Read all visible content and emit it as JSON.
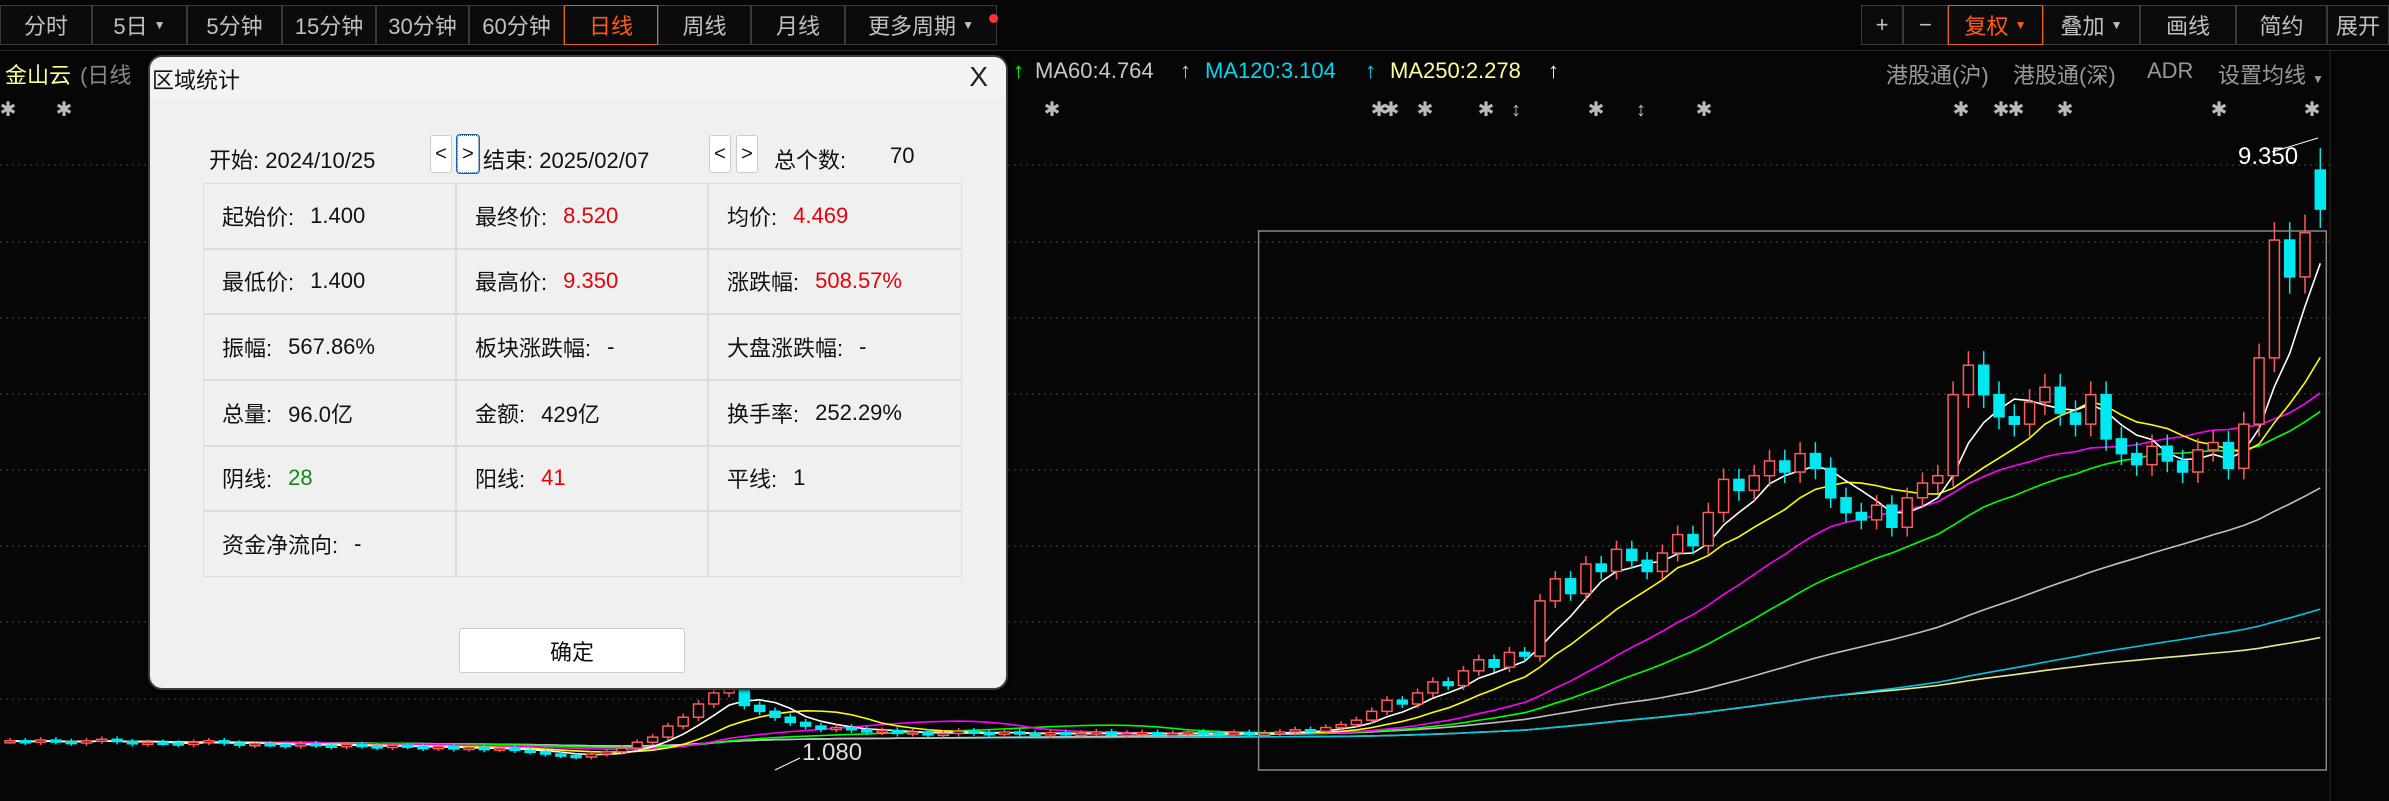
{
  "toolbar": {
    "periods": [
      {
        "label": "分时"
      },
      {
        "label": "5日",
        "caret": true
      },
      {
        "label": "5分钟"
      },
      {
        "label": "15分钟"
      },
      {
        "label": "30分钟"
      },
      {
        "label": "60分钟"
      },
      {
        "label": "日线",
        "active": true
      },
      {
        "label": "周线"
      },
      {
        "label": "月线"
      },
      {
        "label": "更多周期",
        "caret": true,
        "dot": true
      }
    ],
    "right": [
      {
        "label": "+"
      },
      {
        "label": "−"
      },
      {
        "label": "复权",
        "caret": true,
        "active": true
      },
      {
        "label": "叠加",
        "caret": true
      },
      {
        "label": "画线"
      },
      {
        "label": "简约"
      },
      {
        "label": "展开"
      }
    ]
  },
  "legend": {
    "stock": "金山云",
    "period": "(日线",
    "ma60": "MA60:4.764",
    "ma120": "MA120:3.104",
    "ma250": "MA250:2.278",
    "arrow": "↑",
    "links": [
      "港股通(沪)",
      "港股通(深)",
      "ADR",
      "设置均线"
    ]
  },
  "colors": {
    "up": "#ff5a5a",
    "down": "#00e8f0",
    "ma5": "#ffffff",
    "ma10": "#ffff00",
    "ma20": "#ff00ff",
    "ma30": "#00ff00",
    "ma60": "#c0c0c0",
    "ma120": "#00c8e0",
    "ma250": "#e8e890",
    "accent": "#ff5a1a",
    "stock": "#ffff99"
  },
  "chart_data": {
    "type": "candlestick",
    "high_label": "9.350",
    "low_label": "1.080",
    "price_high": 9.35,
    "price_low": 1.08,
    "closes": [
      1.3,
      1.28,
      1.31,
      1.29,
      1.27,
      1.3,
      1.32,
      1.29,
      1.26,
      1.28,
      1.27,
      1.25,
      1.28,
      1.3,
      1.27,
      1.24,
      1.26,
      1.25,
      1.23,
      1.26,
      1.24,
      1.22,
      1.25,
      1.23,
      1.21,
      1.24,
      1.22,
      1.2,
      1.22,
      1.19,
      1.21,
      1.18,
      1.2,
      1.17,
      1.15,
      1.12,
      1.1,
      1.08,
      1.12,
      1.15,
      1.2,
      1.28,
      1.35,
      1.5,
      1.62,
      1.8,
      1.95,
      2.05,
      1.78,
      1.7,
      1.62,
      1.55,
      1.5,
      1.46,
      1.48,
      1.45,
      1.42,
      1.44,
      1.4,
      1.42,
      1.38,
      1.4,
      1.43,
      1.41,
      1.39,
      1.42,
      1.4,
      1.38,
      1.41,
      1.39,
      1.4,
      1.42,
      1.38,
      1.4,
      1.41,
      1.39,
      1.4,
      1.42,
      1.4,
      1.38,
      1.41,
      1.4,
      1.4,
      1.42,
      1.45,
      1.43,
      1.48,
      1.52,
      1.58,
      1.7,
      1.85,
      1.8,
      1.95,
      2.1,
      2.05,
      2.25,
      2.4,
      2.3,
      2.5,
      2.45,
      3.2,
      3.5,
      3.3,
      3.7,
      3.6,
      3.9,
      3.75,
      3.6,
      3.85,
      4.1,
      3.95,
      4.4,
      4.85,
      4.7,
      4.9,
      5.1,
      4.95,
      5.2,
      5.0,
      4.6,
      4.4,
      4.3,
      4.5,
      4.2,
      4.6,
      4.8,
      4.9,
      6.0,
      6.4,
      6.0,
      5.7,
      5.6,
      5.9,
      6.1,
      5.75,
      5.6,
      6.0,
      5.4,
      5.2,
      5.05,
      5.3,
      5.1,
      4.95,
      5.25,
      5.35,
      5.0,
      5.6,
      6.5,
      8.1,
      7.6,
      8.2,
      8.52
    ],
    "selection_start_index": 82
  },
  "dialog": {
    "title": "区域统计",
    "close": "X",
    "start_label": "开始: 2024/10/25",
    "end_label": "结束: 2025/02/07",
    "prev": "<",
    "next": ">",
    "count_label": "总个数:",
    "count": "70",
    "cells": [
      {
        "label": "起始价:",
        "value": "1.400"
      },
      {
        "label": "最终价:",
        "value": "8.520",
        "color": "red"
      },
      {
        "label": "均价:",
        "value": "4.469",
        "color": "red"
      },
      {
        "label": "最低价:",
        "value": "1.400"
      },
      {
        "label": "最高价:",
        "value": "9.350",
        "color": "red"
      },
      {
        "label": "涨跌幅:",
        "value": "508.57%",
        "color": "red"
      },
      {
        "label": "振幅:",
        "value": "567.86%"
      },
      {
        "label": "板块涨跌幅:",
        "value": "-"
      },
      {
        "label": "大盘涨跌幅:",
        "value": "-"
      },
      {
        "label": "总量:",
        "value": "96.0亿"
      },
      {
        "label": "金额:",
        "value": "429亿"
      },
      {
        "label": "换手率:",
        "value": "252.29%"
      },
      {
        "label": "阴线:",
        "value": "28",
        "color": "green"
      },
      {
        "label": "阳线:",
        "value": "41",
        "color": "red"
      },
      {
        "label": "平线:",
        "value": "1"
      },
      {
        "label": "资金净流向:",
        "value": "-"
      },
      {
        "label": "",
        "value": ""
      },
      {
        "label": "",
        "value": ""
      }
    ],
    "ok": "确定"
  }
}
